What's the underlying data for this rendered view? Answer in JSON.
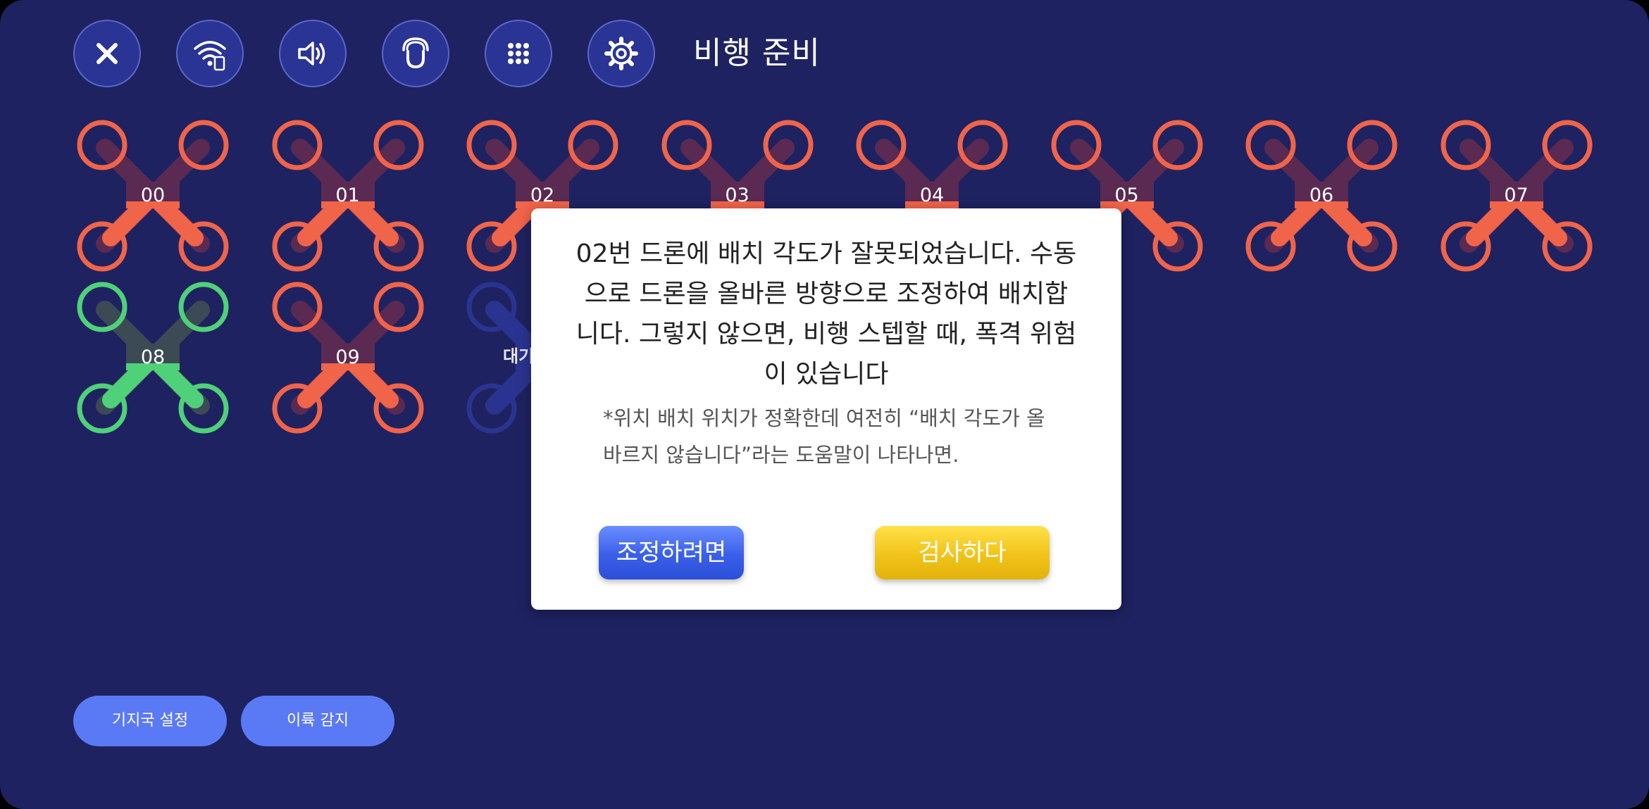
{
  "header": {
    "title": "비행 준비",
    "buttons": [
      {
        "icon": "close-icon"
      },
      {
        "icon": "wifi-device-icon"
      },
      {
        "icon": "speaker-icon"
      },
      {
        "icon": "magnet-icon"
      },
      {
        "icon": "grid-icon"
      },
      {
        "icon": "gear-icon"
      }
    ]
  },
  "drones": [
    {
      "id": "00",
      "status": "error"
    },
    {
      "id": "01",
      "status": "error"
    },
    {
      "id": "02",
      "status": "error"
    },
    {
      "id": "03",
      "status": "error"
    },
    {
      "id": "04",
      "status": "error"
    },
    {
      "id": "05",
      "status": "error"
    },
    {
      "id": "06",
      "status": "error"
    },
    {
      "id": "07",
      "status": "error"
    },
    {
      "id": "08",
      "status": "ready"
    },
    {
      "id": "09",
      "status": "error"
    },
    {
      "id": "",
      "status": "waiting"
    }
  ],
  "waiting_label": "대기",
  "colors": {
    "background": "#1e2260",
    "error": "#f0644a",
    "error_body": "#5a2a52",
    "ready": "#4fd17a",
    "ready_body": "#3c4a55",
    "waiting": "#2e3aa0",
    "adjust_button": "#3a5fe8",
    "check_button": "#f1c319",
    "bottom_button": "#5a79f5"
  },
  "dialog": {
    "message": "02번 드론에 배치 각도가 잘못되었습니다. 수동으로 드론을 올바른 방향으로 조정하여 배치합니다. 그렇지 않으면, 비행 스텝할 때, 폭격 위험이 있습니다",
    "note": "*위치 배치 위치가 정확한데 여전히 “배치 각도가 올바르지 않습니다”라는 도움말이 나타나면.",
    "adjust_label": "조정하려면",
    "check_label": "검사하다"
  },
  "footer": {
    "base_station_label": "기지국 설정",
    "takeoff_detect_label": "이륙 감지"
  }
}
